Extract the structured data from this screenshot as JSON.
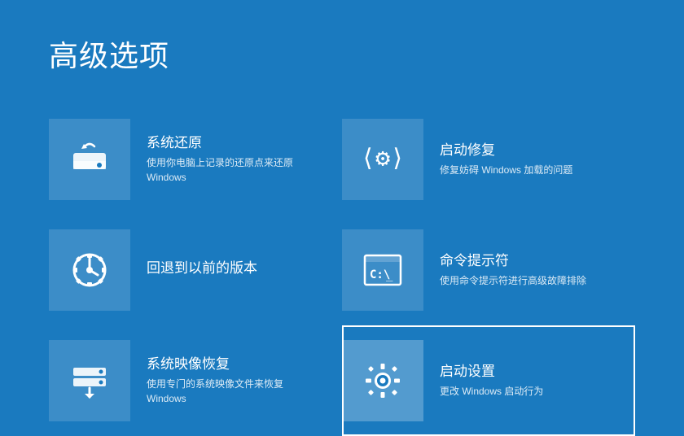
{
  "page": {
    "title": "高级选项",
    "background": "#1a7abf"
  },
  "items": [
    {
      "id": "system-restore",
      "title": "系统还原",
      "desc_line1": "使用你电脑上记录的还原点来还原",
      "desc_line2": "Windows",
      "icon": "restore",
      "selected": false,
      "position": "left"
    },
    {
      "id": "startup-repair",
      "title": "启动修复",
      "desc_line1": "修复妨碍 Windows 加载的问题",
      "desc_line2": "",
      "icon": "startup-repair",
      "selected": false,
      "position": "right"
    },
    {
      "id": "rollback",
      "title": "回退到以前的版本",
      "desc_line1": "",
      "desc_line2": "",
      "icon": "gear",
      "selected": false,
      "position": "left"
    },
    {
      "id": "cmd",
      "title": "命令提示符",
      "desc_line1": "使用命令提示符进行高级故障排除",
      "desc_line2": "",
      "icon": "cmd",
      "selected": false,
      "position": "right"
    },
    {
      "id": "image-recovery",
      "title": "系统映像恢复",
      "desc_line1": "使用专门的系统映像文件来恢复",
      "desc_line2": "Windows",
      "icon": "image-recovery",
      "selected": false,
      "position": "left"
    },
    {
      "id": "startup-settings",
      "title": "启动设置",
      "desc_line1": "更改 Windows 启动行为",
      "desc_line2": "",
      "icon": "gear-settings",
      "selected": true,
      "position": "right"
    }
  ]
}
